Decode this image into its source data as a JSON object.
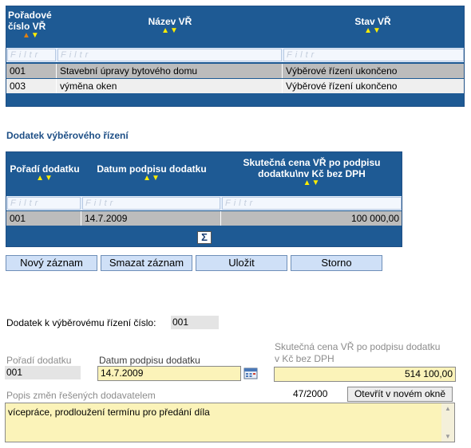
{
  "grid1": {
    "columns": [
      {
        "label_lines": [
          "Pořadové",
          "číslo VŘ"
        ],
        "sorted": true
      },
      {
        "label_lines": [
          "Název VŘ"
        ],
        "sorted": false
      },
      {
        "label_lines": [
          "Stav VŘ"
        ],
        "sorted": false
      }
    ],
    "filter_placeholder": "Filtr",
    "rows": [
      {
        "cells": [
          "001",
          "Stavební úpravy bytového domu",
          "Výběrové řízení ukončeno"
        ],
        "selected": true
      },
      {
        "cells": [
          "003",
          "výměna oken",
          "Výběrové řízení ukončeno"
        ],
        "selected": false
      }
    ]
  },
  "section_title": "Dodatek výběrového řízení",
  "grid2": {
    "columns": [
      {
        "label_lines": [
          "Pořadí dodatku"
        ]
      },
      {
        "label_lines": [
          "Datum podpisu dodatku"
        ]
      },
      {
        "label_lines": [
          "Skutečná cena VŘ po podpisu",
          "dodatku\\nv Kč bez DPH"
        ]
      }
    ],
    "filter_placeholder": "Filtr",
    "rows": [
      {
        "cells": [
          "001",
          "14.7.2009",
          "100 000,00"
        ],
        "selected": true
      }
    ],
    "sum_symbol": "Σ"
  },
  "buttons": {
    "new": "Nový záznam",
    "delete": "Smazat záznam",
    "save": "Uložit",
    "cancel": "Storno"
  },
  "form": {
    "supplement_number_label": "Dodatek k výběrovému řízení číslo:",
    "supplement_number_value": "001",
    "order_label": "Pořadí dodatku",
    "order_value": "001",
    "date_label": "Datum podpisu dodatku",
    "date_value": "14.7.2009",
    "price_label_line1": "Skutečná cena VŘ po podpisu dodatku",
    "price_label_line2": "v Kč bez DPH",
    "price_value": "514 100,00",
    "desc_label": "Popis změn řešených dodavatelem",
    "char_count": "47/2000",
    "open_window_label": "Otevřít v novém okně",
    "desc_value": "vícepráce, prodloužení termínu pro předání díla"
  }
}
